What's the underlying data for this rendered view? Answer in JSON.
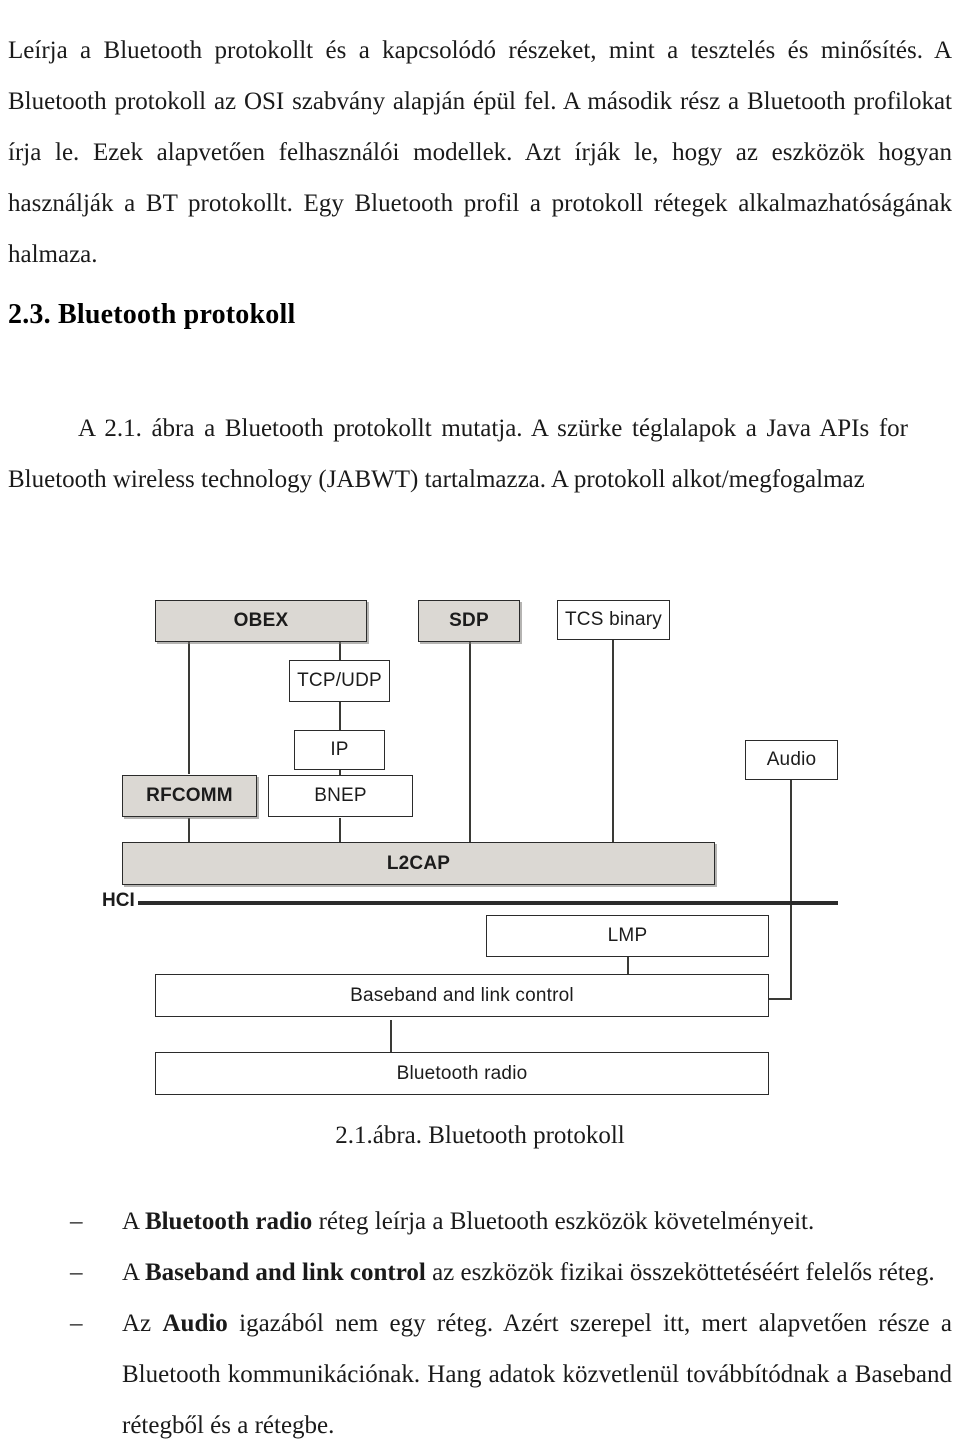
{
  "document": {
    "intro_paragraph": "Leírja a Bluetooth protokollt és a kapcsolódó részeket, mint a tesztelés és minősítés. A Bluetooth protokoll az OSI szabvány alapján épül fel. A második rész a Bluetooth profilokat írja le. Ezek alapvetően felhasználói modellek. Azt írják le, hogy az eszközök hogyan használják a BT protokollt. Egy Bluetooth profil a protokoll rétegek alkalmazhatóságának halmaza.",
    "section_heading": "2.3. Bluetooth protokoll",
    "figure_intro_paragraph": "A 2.1. ábra a Bluetooth protokollt mutatja. A szürke téglalapok a Java APIs for Bluetooth wireless technology (JABWT) tartalmazza. A protokoll alkot/megfogalmaz",
    "figure_caption": "2.1.ábra. Bluetooth protokoll"
  },
  "figure": {
    "hci_label": "HCI",
    "shaded_color": "#dbd8d3",
    "line_color": "#3a3a36",
    "nodes": [
      {
        "id": "obex",
        "label": "OBEX",
        "shaded": true
      },
      {
        "id": "sdp",
        "label": "SDP",
        "shaded": true
      },
      {
        "id": "tcs",
        "label": "TCS binary",
        "shaded": false
      },
      {
        "id": "tcpudp",
        "label": "TCP/UDP",
        "shaded": false
      },
      {
        "id": "ip",
        "label": "IP",
        "shaded": false
      },
      {
        "id": "rfcomm",
        "label": "RFCOMM",
        "shaded": true
      },
      {
        "id": "bnep",
        "label": "BNEP",
        "shaded": false
      },
      {
        "id": "audio",
        "label": "Audio",
        "shaded": false
      },
      {
        "id": "l2cap",
        "label": "L2CAP",
        "shaded": true
      },
      {
        "id": "lmp",
        "label": "LMP",
        "shaded": false
      },
      {
        "id": "baseband",
        "label": "Baseband and link control",
        "shaded": false
      },
      {
        "id": "radio",
        "label": "Bluetooth radio",
        "shaded": false
      }
    ]
  },
  "notes": {
    "dash": "–",
    "items": [
      {
        "prefix": "A ",
        "bold": "Bluetooth radio",
        "suffix": " réteg leírja a Bluetooth eszközök követelményeit."
      },
      {
        "prefix": "A ",
        "bold": "Baseband and link control",
        "suffix": " az eszközök fizikai összeköttetéséért felelős réteg."
      },
      {
        "prefix": "Az ",
        "bold": "Audio",
        "suffix": " igazából nem egy réteg. Azért szerepel itt, mert alapvetően része a Bluetooth kommunikációnak. Hang adatok közvetlenül továbbítódnak a Baseband rétegből és a rétegbe."
      }
    ]
  }
}
